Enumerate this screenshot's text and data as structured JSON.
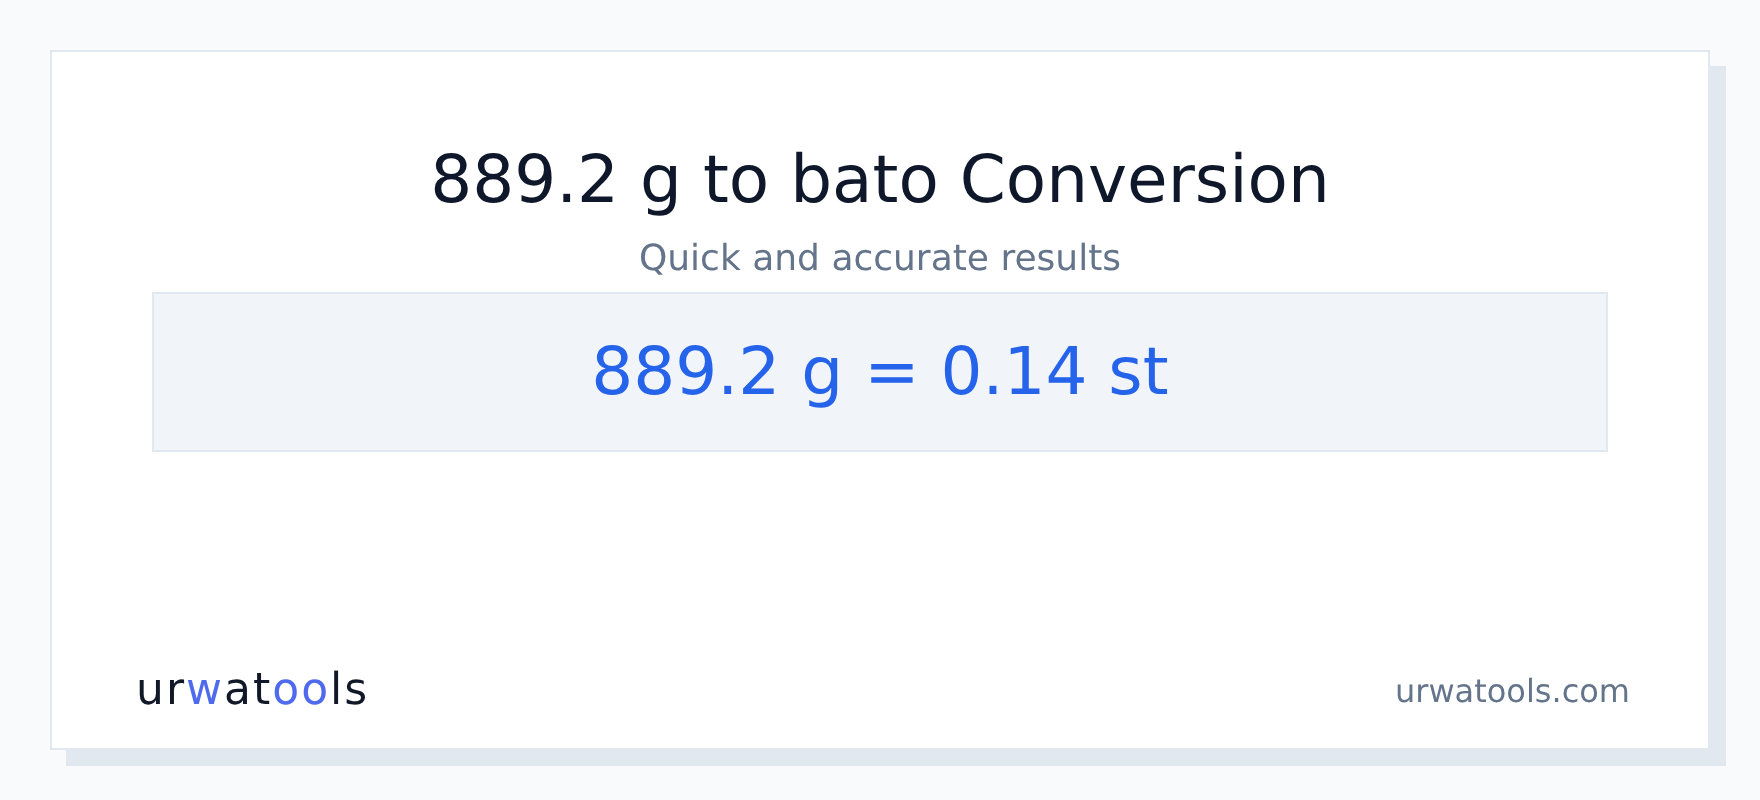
{
  "title": "889.2 g to bato Conversion",
  "subtitle": "Quick and accurate results",
  "result": "889.2 g = 0.14 st",
  "logo": {
    "parts": [
      {
        "text": "ur",
        "highlighted": false
      },
      {
        "text": "w",
        "highlighted": true
      },
      {
        "text": "at",
        "highlighted": false
      },
      {
        "text": "oo",
        "highlighted": true
      },
      {
        "text": "ls",
        "highlighted": false
      }
    ]
  },
  "site": "urwatools.com"
}
